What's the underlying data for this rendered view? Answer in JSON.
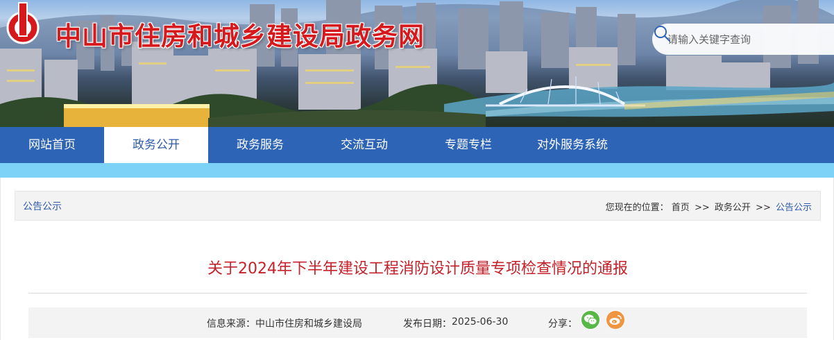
{
  "header": {
    "site_title": "中山市住房和城乡建设局政务网",
    "logo_icon": "zhongshan-emblem-icon",
    "search": {
      "placeholder": "请输入关键字查询",
      "icon": "search-icon"
    }
  },
  "nav": {
    "items": [
      {
        "label": "网站首页",
        "active": false
      },
      {
        "label": "政务公开",
        "active": true
      },
      {
        "label": "政务服务",
        "active": false
      },
      {
        "label": "交流互动",
        "active": false
      },
      {
        "label": "专题专栏",
        "active": false
      },
      {
        "label": "对外服务系统",
        "active": false
      }
    ]
  },
  "section": {
    "label": "公告公示"
  },
  "breadcrumb": {
    "prefix": "您现在的位置：",
    "items": [
      "首页",
      "政务公开",
      "公告公示"
    ],
    "separator": ">>"
  },
  "article": {
    "title": "关于2024年下半年建设工程消防设计质量专项检查情况的通报",
    "source_label": "信息来源：",
    "source_value": "中山市住房和城乡建设局",
    "date_label": "发布日期：",
    "date_value": "2025-06-30",
    "share_label": "分享："
  },
  "share": {
    "icons": [
      "wechat-icon",
      "weibo-icon"
    ]
  },
  "colors": {
    "nav_bg": "#2e64b6",
    "stripe": "#7dd2f8",
    "title_red": "#c4222a",
    "link_blue": "#2d5aa8",
    "site_title_red": "#d6191c"
  }
}
